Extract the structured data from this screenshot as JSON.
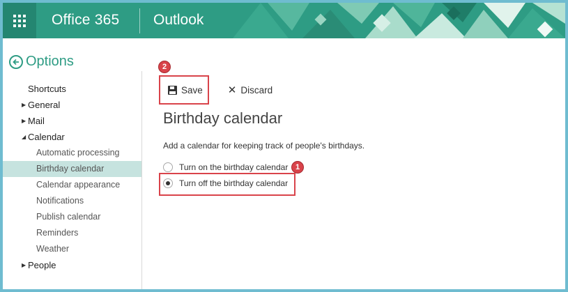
{
  "header": {
    "brand": "Office 365",
    "app": "Outlook"
  },
  "options": {
    "title": "Options"
  },
  "sidebar": {
    "items": [
      {
        "label": "Shortcuts",
        "level": "top",
        "caret": ""
      },
      {
        "label": "General",
        "level": "top",
        "caret": "collapsed"
      },
      {
        "label": "Mail",
        "level": "top",
        "caret": "collapsed"
      },
      {
        "label": "Calendar",
        "level": "top",
        "caret": "expanded"
      },
      {
        "label": "Automatic processing",
        "level": "sub"
      },
      {
        "label": "Birthday calendar",
        "level": "sub",
        "selected": true
      },
      {
        "label": "Calendar appearance",
        "level": "sub"
      },
      {
        "label": "Notifications",
        "level": "sub"
      },
      {
        "label": "Publish calendar",
        "level": "sub"
      },
      {
        "label": "Reminders",
        "level": "sub"
      },
      {
        "label": "Weather",
        "level": "sub"
      },
      {
        "label": "People",
        "level": "top",
        "caret": "collapsed"
      }
    ]
  },
  "toolbar": {
    "save_label": "Save",
    "discard_label": "Discard"
  },
  "main": {
    "title": "Birthday calendar",
    "description": "Add a calendar for keeping track of people's birthdays.",
    "options": [
      {
        "label": "Turn on the birthday calendar",
        "checked": false
      },
      {
        "label": "Turn off the birthday calendar",
        "checked": true
      }
    ]
  },
  "annotations": {
    "badge_1": "1",
    "badge_2": "2"
  },
  "colors": {
    "accent": "#2e9c84",
    "selected_bg": "#c6e3df",
    "callout": "#d9434a"
  }
}
